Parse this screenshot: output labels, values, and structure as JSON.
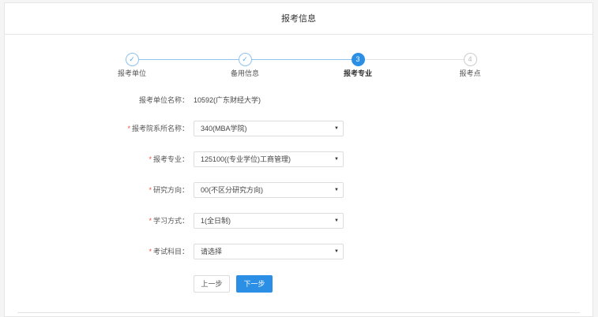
{
  "header": {
    "title": "报考信息"
  },
  "steps": [
    {
      "label": "报考单位",
      "status": "done",
      "mark": "✓"
    },
    {
      "label": "备用信息",
      "status": "done",
      "mark": "✓"
    },
    {
      "label": "报考专业",
      "status": "active",
      "mark": "3"
    },
    {
      "label": "报考点",
      "status": "todo",
      "mark": "4"
    }
  ],
  "form": {
    "unit": {
      "label": "报考单位名称：",
      "value": "10592(广东财经大学)"
    },
    "fields": [
      {
        "label": "报考院系所名称：",
        "value": "340(MBA学院)"
      },
      {
        "label": "报考专业：",
        "value": "125100((专业学位)工商管理)"
      },
      {
        "label": "研究方向：",
        "value": "00(不区分研究方向)"
      },
      {
        "label": "学习方式：",
        "value": "1(全日制)"
      },
      {
        "label": "考试科目：",
        "value": "请选择"
      }
    ],
    "required_mark": "*",
    "arrow": "▼"
  },
  "buttons": {
    "prev": "上一步",
    "next": "下一步"
  },
  "colors": {
    "accent": "#2b8fe6",
    "required": "#e8553e"
  }
}
